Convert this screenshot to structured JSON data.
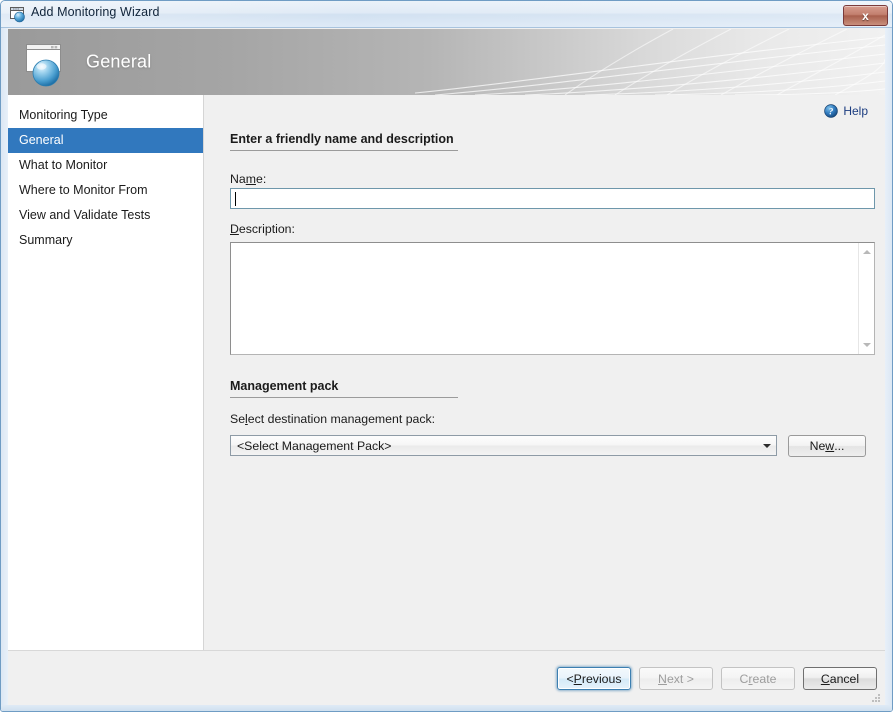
{
  "window": {
    "title": "Add Monitoring Wizard",
    "icon": "wizard-window-icon",
    "close_label": "x"
  },
  "banner": {
    "heading": "General",
    "icon": "wizard-page-icon"
  },
  "sidebar": {
    "items": [
      {
        "label": "Monitoring Type",
        "selected": false
      },
      {
        "label": "General",
        "selected": true
      },
      {
        "label": "What to Monitor",
        "selected": false
      },
      {
        "label": "Where to Monitor From",
        "selected": false
      },
      {
        "label": "View and Validate Tests",
        "selected": false
      },
      {
        "label": "Summary",
        "selected": false
      }
    ]
  },
  "main": {
    "help": {
      "label": "Help",
      "icon": "help-circle-icon"
    },
    "section_general": {
      "heading": "Enter a friendly name and description",
      "name_label_pre": "Na",
      "name_label_mnemonic": "m",
      "name_label_post": "e:",
      "name_value": "",
      "description_label_mnemonic": "D",
      "description_label_post": "escription:",
      "description_value": ""
    },
    "section_mp": {
      "heading": "Management pack",
      "select_label_pre": "Se",
      "select_label_mnemonic": "l",
      "select_label_post": "ect destination management pack:",
      "combo_value": "<Select Management Pack>",
      "new_button_pre": "Ne",
      "new_button_mnemonic": "w",
      "new_button_post": "..."
    }
  },
  "footer": {
    "buttons": [
      {
        "name": "previous",
        "pre": "< ",
        "mnemonic": "P",
        "post": "revious",
        "state": "focused"
      },
      {
        "name": "next",
        "pre": "",
        "mnemonic": "N",
        "post": "ext >",
        "state": "disabled"
      },
      {
        "name": "create",
        "pre": "C",
        "mnemonic": "r",
        "post": "eate",
        "state": "disabled"
      },
      {
        "name": "cancel",
        "pre": "",
        "mnemonic": "C",
        "post": "ancel",
        "state": "default"
      }
    ]
  },
  "colors": {
    "selection_blue": "#3178be",
    "help_text": "#1c3d80",
    "focus_border": "#3c7fb1",
    "banner_text": "#ffffff"
  }
}
